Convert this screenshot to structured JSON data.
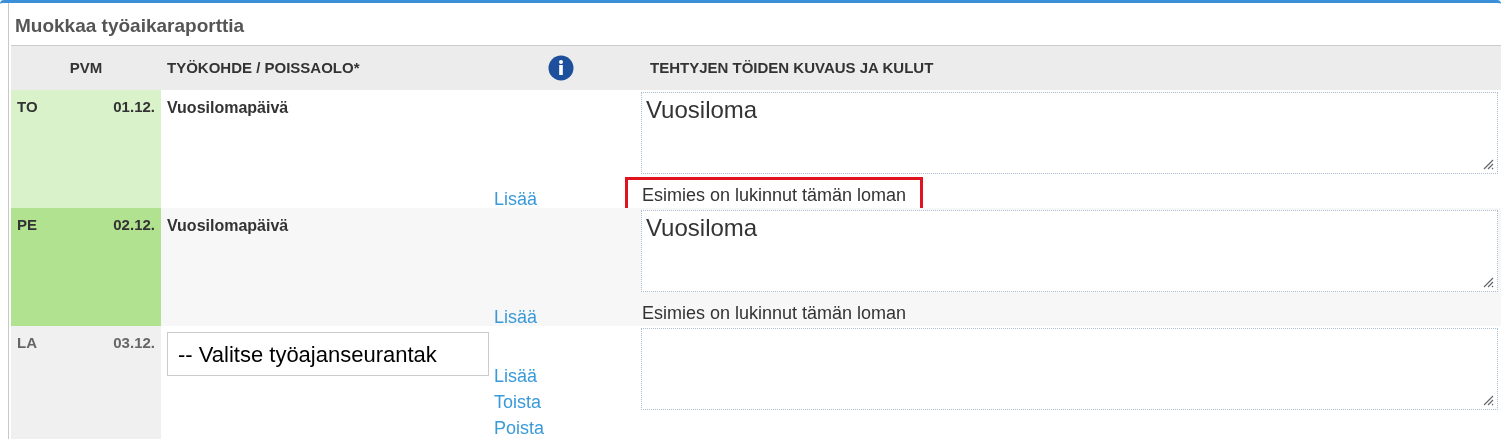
{
  "title": "Muokkaa työaikaraporttia",
  "columns": [
    "PVM",
    "TYÖKOHDE / POISSAOLO*",
    "TEHTYJEN TÖIDEN KUVAUS JA KULUT"
  ],
  "rows": [
    {
      "day": "TO",
      "date": "01.12.",
      "color": "#d9f2c9",
      "dimmed": false,
      "kind": "locked",
      "work": "Vuosilomapäivä",
      "links": [
        "Lisää"
      ],
      "description": "Vuosiloma",
      "note": "Esimies on lukinnut tämän loman",
      "highlighted": true
    },
    {
      "day": "PE",
      "date": "02.12.",
      "color": "#b0e290",
      "dimmed": false,
      "kind": "locked",
      "work": "Vuosilomapäivä",
      "links": [
        "Lisää"
      ],
      "description": "Vuosiloma",
      "note": "Esimies on lukinnut tämän loman",
      "highlighted": false
    },
    {
      "day": "LA",
      "date": "03.12.",
      "color": "#f0f0f0",
      "dimmed": true,
      "kind": "select",
      "select_value": "-- Valitse työajanseurantak",
      "links": [
        "Lisää",
        "Toista",
        "Poista"
      ]
    }
  ]
}
